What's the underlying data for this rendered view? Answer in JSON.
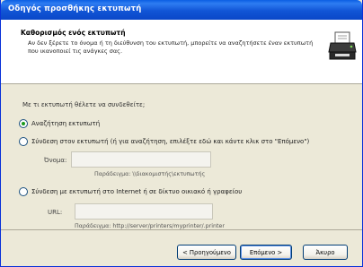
{
  "window": {
    "title": "Οδηγός προσθήκης εκτυπωτή"
  },
  "header": {
    "title": "Καθορισμός ενός εκτυπωτή",
    "description": "Αν δεν ξέρετε το όνομα ή τη διεύθυνση του εκτυπωτή, μπορείτε να αναζητήσετε έναν εκτυπωτή που ικανοποιεί τις ανάγκες σας."
  },
  "content": {
    "question": "Με τι εκτυπωτή θέλετε να συνδεθείτε;",
    "options": [
      {
        "label": "Αναζήτηση εκτυπωτή",
        "selected": true
      },
      {
        "label": "Σύνδεση στον εκτυπωτή (ή για αναζήτηση, επιλέξτε εδώ και κάντε κλικ στο \"Επόμενο\")",
        "selected": false
      },
      {
        "label": "Σύνδεση με εκτυπωτή στο Internet ή σε δίκτυο οικιακό ή γραφείου",
        "selected": false
      }
    ],
    "name_field": {
      "label": "Όνομα:",
      "value": "",
      "hint": "Παράδειγμα: \\\\διακομιστής\\εκτυπωτής"
    },
    "url_field": {
      "label": "URL:",
      "value": "",
      "hint": "Παράδειγμα: http://server/printers/myprinter/.printer"
    }
  },
  "footer": {
    "back_label": "< Προηγούμενο",
    "next_label": "Επόμενο >",
    "cancel_label": "Άκυρο"
  }
}
